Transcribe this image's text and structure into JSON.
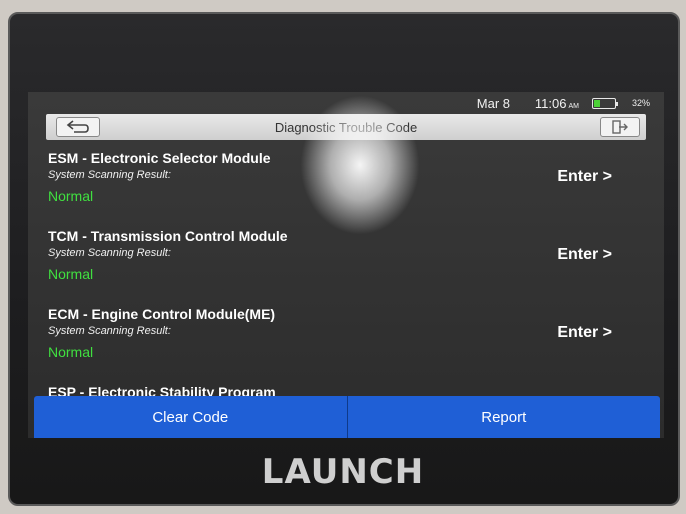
{
  "status_bar": {
    "date": "Mar 8",
    "time": "11:06",
    "ampm": "AM",
    "battery_pct": "32%",
    "battery_level": 0.32
  },
  "header": {
    "title": "Diagnostic Trouble Code",
    "back_icon": "back-arrow-icon",
    "exit_icon": "exit-icon"
  },
  "modules": [
    {
      "name": "ESM - Electronic Selector Module",
      "subtitle": "System Scanning Result:",
      "status": "Normal",
      "action": "Enter >"
    },
    {
      "name": "TCM - Transmission Control Module",
      "subtitle": "System Scanning Result:",
      "status": "Normal",
      "action": "Enter >"
    },
    {
      "name": "ECM - Engine Control Module(ME)",
      "subtitle": "System Scanning Result:",
      "status": "Normal",
      "action": "Enter >"
    },
    {
      "name": "ESP - Electronic Stability Program"
    }
  ],
  "footer": {
    "clear_label": "Clear Code",
    "report_label": "Report"
  },
  "brand": "LAUNCH",
  "colors": {
    "accent": "#1f5fd6",
    "status_ok": "#40e040"
  }
}
